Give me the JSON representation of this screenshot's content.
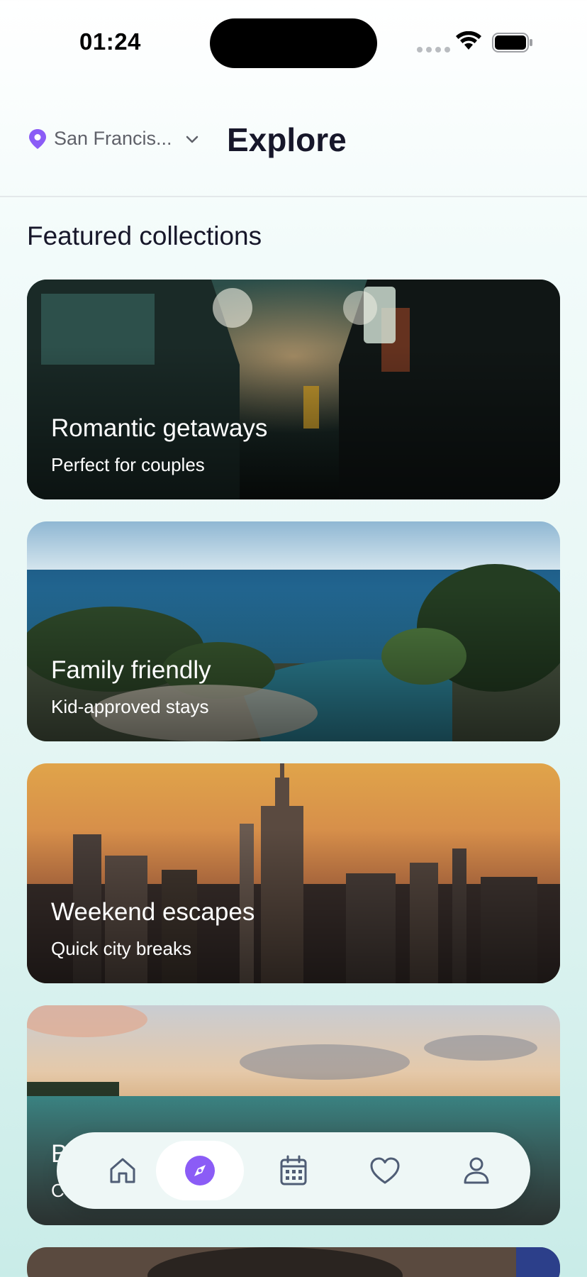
{
  "status": {
    "time": "01:24"
  },
  "header": {
    "location": "San Francis...",
    "title": "Explore"
  },
  "section": {
    "title": "Featured collections"
  },
  "collections": [
    {
      "title": "Romantic getaways",
      "subtitle": "Perfect for couples"
    },
    {
      "title": "Family friendly",
      "subtitle": "Kid-approved stays"
    },
    {
      "title": "Weekend escapes",
      "subtitle": "Quick city breaks"
    },
    {
      "title": "B",
      "subtitle": "C"
    }
  ],
  "nav": {
    "items": [
      {
        "icon": "home-icon"
      },
      {
        "icon": "compass-icon",
        "active": true
      },
      {
        "icon": "calendar-icon"
      },
      {
        "icon": "heart-icon"
      },
      {
        "icon": "profile-icon"
      }
    ]
  },
  "colors": {
    "accent": "#8b5cf6",
    "nav_icon": "#4f5d75"
  }
}
